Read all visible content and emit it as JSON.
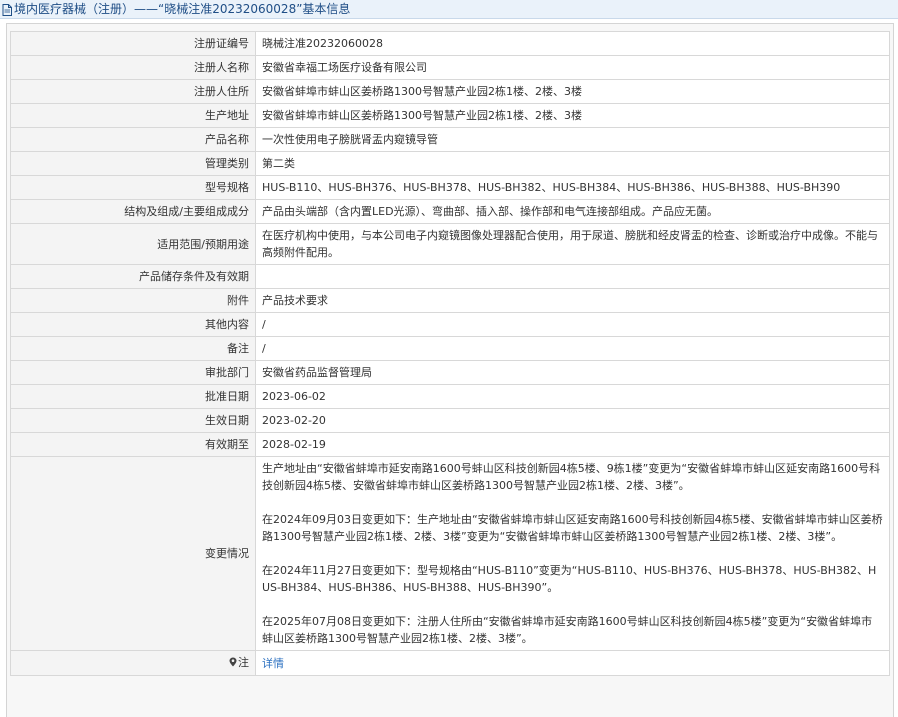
{
  "header": {
    "title": "境内医疗器械（注册）——“晓械注准20232060028”基本信息"
  },
  "rows": [
    {
      "label": "注册证编号",
      "value": "晓械注准20232060028"
    },
    {
      "label": "注册人名称",
      "value": "安徽省幸福工场医疗设备有限公司"
    },
    {
      "label": "注册人住所",
      "value": "安徽省蚌埠市蚌山区姜桥路1300号智慧产业园2栋1楼、2楼、3楼"
    },
    {
      "label": "生产地址",
      "value": "安徽省蚌埠市蚌山区姜桥路1300号智慧产业园2栋1楼、2楼、3楼"
    },
    {
      "label": "产品名称",
      "value": "一次性使用电子膀胱肾盂内窥镜导管"
    },
    {
      "label": "管理类别",
      "value": "第二类"
    },
    {
      "label": "型号规格",
      "value": "HUS-B110、HUS-BH376、HUS-BH378、HUS-BH382、HUS-BH384、HUS-BH386、HUS-BH388、HUS-BH390"
    },
    {
      "label": "结构及组成/主要组成成分",
      "value": "产品由头端部（含内置LED光源）、弯曲部、插入部、操作部和电气连接部组成。产品应无菌。"
    },
    {
      "label": "适用范围/预期用途",
      "value": "在医疗机构中使用，与本公司电子内窥镜图像处理器配合使用，用于尿道、膀胱和经皮肾盂的检查、诊断或治疗中成像。不能与高频附件配用。"
    },
    {
      "label": "产品储存条件及有效期",
      "value": ""
    },
    {
      "label": "附件",
      "value": "产品技术要求"
    },
    {
      "label": "其他内容",
      "value": "/"
    },
    {
      "label": "备注",
      "value": "/"
    },
    {
      "label": "审批部门",
      "value": "安徽省药品监督管理局"
    },
    {
      "label": "批准日期",
      "value": "2023-06-02"
    },
    {
      "label": "生效日期",
      "value": "2023-02-20"
    },
    {
      "label": "有效期至",
      "value": "2028-02-19"
    }
  ],
  "changes": {
    "label": "变更情况",
    "items": [
      "生产地址由“安徽省蚌埠市延安南路1600号蚌山区科技创新园4栋5楼、9栋1楼”变更为“安徽省蚌埠市蚌山区延安南路1600号科技创新园4栋5楼、安徽省蚌埠市蚌山区姜桥路1300号智慧产业园2栋1楼、2楼、3楼”。",
      "在2024年09月03日变更如下：生产地址由“安徽省蚌埠市蚌山区延安南路1600号科技创新园4栋5楼、安徽省蚌埠市蚌山区姜桥路1300号智慧产业园2栋1楼、2楼、3楼”变更为“安徽省蚌埠市蚌山区姜桥路1300号智慧产业园2栋1楼、2楼、3楼”。",
      "在2024年11月27日变更如下：型号规格由“HUS-B110”变更为“HUS-B110、HUS-BH376、HUS-BH378、HUS-BH382、HUS-BH384、HUS-BH386、HUS-BH388、HUS-BH390”。",
      "在2025年07月08日变更如下：注册人住所由“安徽省蚌埠市延安南路1600号蚌山区科技创新园4栋5楼”变更为“安徽省蚌埠市蚌山区姜桥路1300号智慧产业园2栋1楼、2楼、3楼”。"
    ]
  },
  "footer": {
    "label": "注",
    "link": "详情",
    "icon": "map-pin-icon"
  },
  "colors": {
    "link": "#2a6fc0",
    "header_text": "#1f4e86",
    "header_bg": "#eaf2fa",
    "label_bg": "#f4f4f4",
    "border": "#d8d8d8"
  }
}
